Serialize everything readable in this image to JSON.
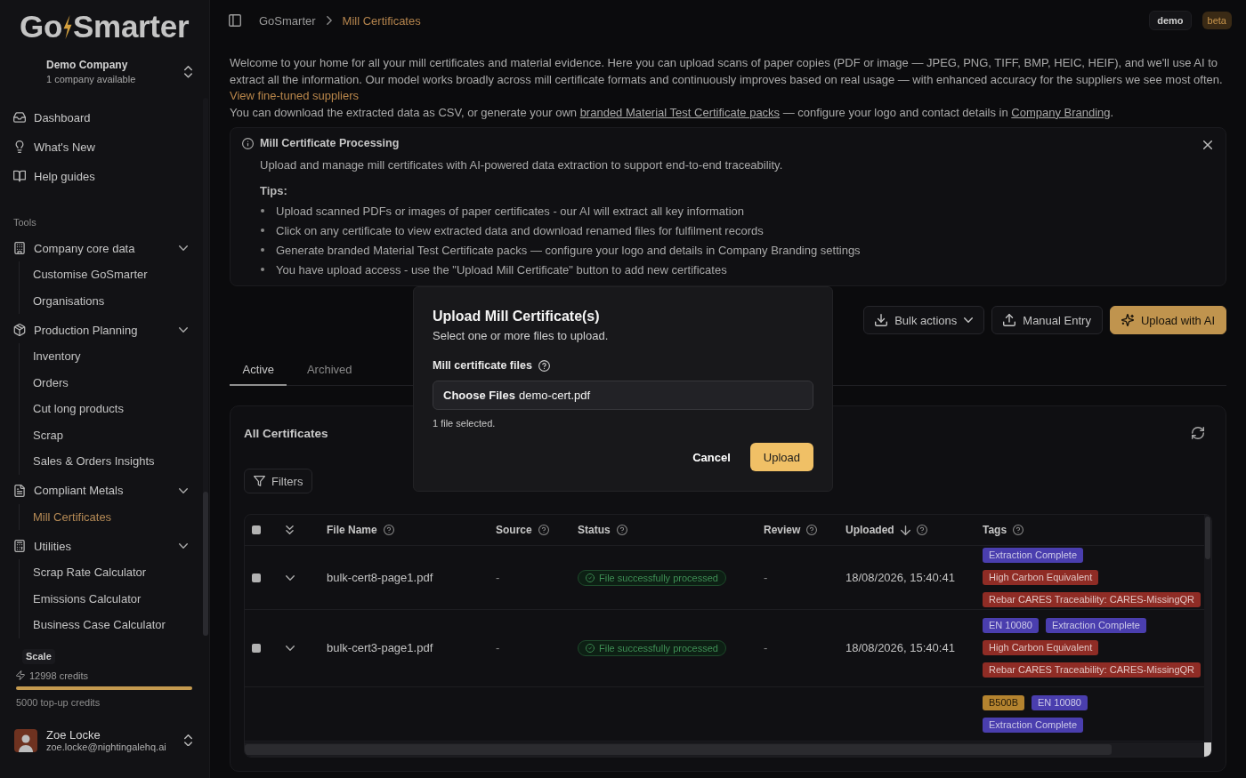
{
  "sidebar": {
    "logo": [
      "Go",
      "Smarter"
    ],
    "company": {
      "name": "Demo Company",
      "count": "1 company available"
    },
    "nav": [
      {
        "label": "Dashboard",
        "selected": false
      },
      {
        "label": "What's New",
        "selected": false
      },
      {
        "label": "Help guides",
        "selected": false
      }
    ],
    "section_label": "Tools",
    "groups": [
      {
        "label": "Company core data",
        "expanded": true,
        "children": [
          {
            "label": "Customise GoSmarter",
            "selected": false
          },
          {
            "label": "Organisations",
            "selected": false
          }
        ]
      },
      {
        "label": "Production Planning",
        "expanded": true,
        "children": [
          {
            "label": "Inventory",
            "selected": false
          },
          {
            "label": "Orders",
            "selected": false
          },
          {
            "label": "Cut long products",
            "selected": false
          },
          {
            "label": "Scrap",
            "selected": false
          },
          {
            "label": "Sales & Orders Insights",
            "selected": false
          }
        ]
      },
      {
        "label": "Compliant Metals",
        "expanded": true,
        "children": [
          {
            "label": "Mill Certificates",
            "selected": true
          }
        ]
      },
      {
        "label": "Utilities",
        "expanded": true,
        "children": [
          {
            "label": "Scrap Rate Calculator",
            "selected": false
          },
          {
            "label": "Emissions Calculator",
            "selected": false
          },
          {
            "label": "Business Case Calculator",
            "selected": false
          }
        ]
      }
    ],
    "plan": {
      "name": "Scale",
      "credits": "12998 credits",
      "level": 1,
      "topup": "5000 top-up credits"
    },
    "user": {
      "name": "Zoe Locke",
      "email": "zoe.locke@nightingalehq.ai"
    }
  },
  "header": {
    "breadcrumb": [
      {
        "label": "GoSmarter",
        "current": false
      },
      {
        "label": "Mill Certificates",
        "current": true
      }
    ],
    "badges": [
      {
        "label": "demo",
        "kind": "neutral"
      },
      {
        "label": "beta",
        "kind": "accent"
      }
    ]
  },
  "intro": [
    {
      "parts": [
        {
          "kind": "text",
          "text": "Welcome to your home for all your mill certificates and material evidence. Here you can upload scans of paper copies (PDF or image — JPEG, PNG, TIFF, BMP, HEIC, HEIF), and we'll use AI to extract all the information. Our model works broadly across mill certificate formats and continuously improves based on real usage — with enhanced accuracy for the suppliers we see most often. "
        },
        {
          "kind": "accent",
          "text": "View fine-tuned suppliers"
        }
      ]
    },
    {
      "parts": [
        {
          "kind": "text",
          "text": "You can download the extracted data as CSV, or generate your own "
        },
        {
          "kind": "link",
          "text": "branded Material Test Certificate packs"
        },
        {
          "kind": "text",
          "text": " — configure your logo and contact details in "
        },
        {
          "kind": "link",
          "text": "Company Branding"
        },
        {
          "kind": "text",
          "text": "."
        }
      ]
    }
  ],
  "info_card": {
    "title": "Mill Certificate Processing",
    "description": "Upload and manage mill certificates with AI-powered data extraction to support end-to-end traceability.",
    "tips_label": "Tips:",
    "tips": [
      "Upload scanned PDFs or images of paper certificates - our AI will extract all key information",
      "Click on any certificate to view extracted data and download renamed files for fulfilment records",
      "Generate branded Material Test Certificate packs — configure your logo and details in Company Branding settings",
      "You have upload access - use the \"Upload Mill Certificate\" button to add new certificates"
    ]
  },
  "actions": [
    {
      "label": "Bulk actions",
      "kind": "menu"
    },
    {
      "label": "Manual Entry",
      "kind": "secondary"
    },
    {
      "label": "Upload with AI",
      "kind": "primary"
    }
  ],
  "tabs": [
    {
      "label": "Active",
      "selected": true
    },
    {
      "label": "Archived",
      "selected": false
    }
  ],
  "certificates": {
    "title": "All Certificates",
    "filters": "Filters",
    "select_all_checked": false,
    "columns": [
      {
        "label": "File Name",
        "sorted": false
      },
      {
        "label": "Source",
        "sorted": false
      },
      {
        "label": "Status",
        "sorted": false
      },
      {
        "label": "Review",
        "sorted": false
      },
      {
        "label": "Uploaded",
        "sorted": true
      },
      {
        "label": "Tags",
        "sorted": false
      }
    ],
    "rows": [
      {
        "checked": false,
        "expanded": false,
        "file_name": "bulk-cert8-page1.pdf",
        "source": "-",
        "status": {
          "label": "File successfully processed",
          "kind": "success"
        },
        "review": "-",
        "uploaded": "18/08/2026, 15:40:41",
        "tags": [
          {
            "label": "Extraction Complete",
            "color": "#4a3eae"
          },
          {
            "label": "High Carbon Equivalent",
            "color": "#8f2c25"
          },
          {
            "label": "Rebar CARES Traceability: CARES-MissingQR",
            "color": "#8f2c25"
          }
        ]
      },
      {
        "checked": false,
        "expanded": false,
        "file_name": "bulk-cert3-page1.pdf",
        "source": "-",
        "status": {
          "label": "File successfully processed",
          "kind": "success"
        },
        "review": "-",
        "uploaded": "18/08/2026, 15:40:41",
        "tags": [
          {
            "label": "EN 10080",
            "color": "#4a3eae"
          },
          {
            "label": "Extraction Complete",
            "color": "#4a3eae"
          },
          {
            "label": "High Carbon Equivalent",
            "color": "#8f2c25"
          },
          {
            "label": "Rebar CARES Traceability: CARES-MissingQR",
            "color": "#8f2c25"
          }
        ]
      },
      {
        "tags": [
          {
            "label": "B500B",
            "color": "#b4832f"
          },
          {
            "label": "EN 10080",
            "color": "#4a3eae"
          },
          {
            "label": "Extraction Complete",
            "color": "#4a3eae"
          }
        ]
      }
    ]
  },
  "modal": {
    "title": "Upload Mill Certificate(s)",
    "subtitle": "Select one or more files to upload.",
    "field_label": "Mill certificate files",
    "file_button": "Choose Files",
    "file_name": "demo-cert.pdf",
    "hint": "1 file selected.",
    "buttons": [
      {
        "label": "Cancel",
        "kind": "ghost"
      },
      {
        "label": "Upload",
        "kind": "primary"
      }
    ]
  }
}
